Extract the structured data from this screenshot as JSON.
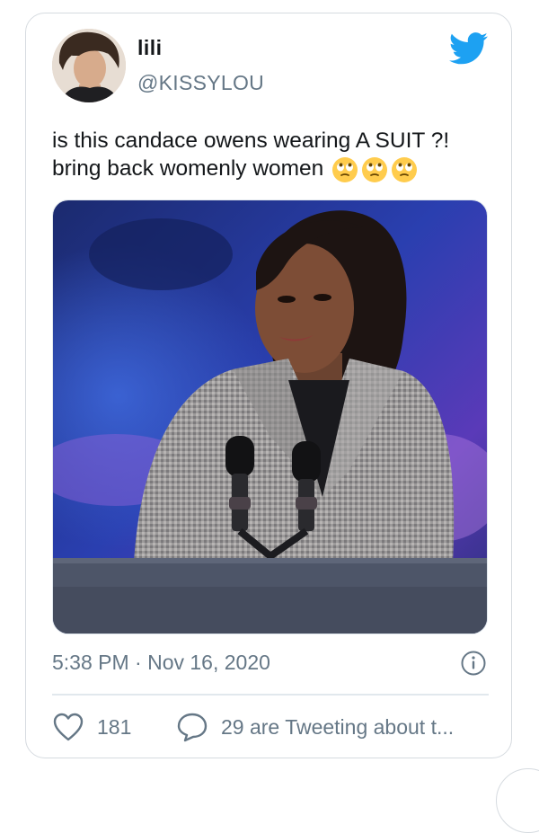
{
  "tweet": {
    "display_name": "lili",
    "handle": "@KISSYLOU",
    "text_line1": "is this candace owens wearing A SUIT ?!",
    "text_line2": "bring back womenly women",
    "emojis": [
      "rolling-eyes-emoji",
      "rolling-eyes-emoji",
      "rolling-eyes-emoji"
    ],
    "timestamp": "5:38 PM · Nov 16, 2020",
    "likes": "181",
    "tweeting_about": "29 are Tweeting about t..."
  },
  "colors": {
    "twitter_blue": "#1da1f2",
    "text": "#14171a",
    "muted": "#657786",
    "border": "#e1e8ed"
  },
  "icons": {
    "logo": "twitter-bird-icon",
    "info": "info-icon",
    "like": "heart-icon",
    "reply": "speech-bubble-icon"
  }
}
